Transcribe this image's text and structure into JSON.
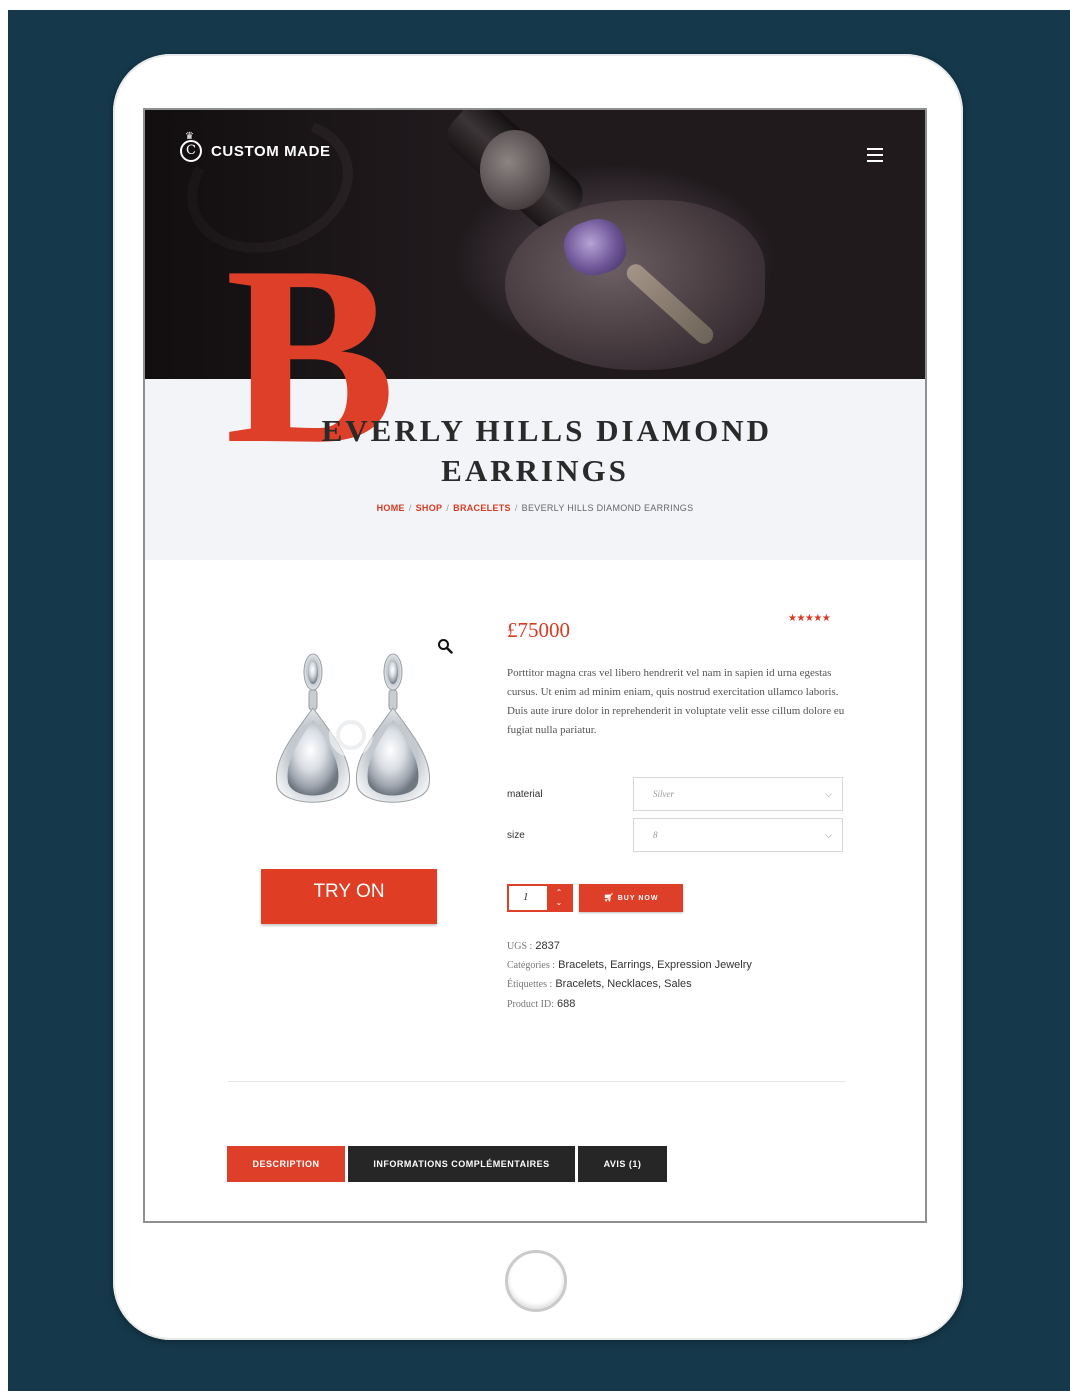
{
  "brand": {
    "name": "CUSTOM MADE",
    "logo_letter": "C"
  },
  "colors": {
    "accent": "#dd3f28",
    "frame_bg": "#15394b",
    "dark_tab": "#262626"
  },
  "page": {
    "title_initial": "B",
    "title_line1_rest": "EVERLY HILLS DIAMOND",
    "title_line2": "EARRINGS"
  },
  "breadcrumb": [
    {
      "label": "HOME"
    },
    {
      "label": "SHOP"
    },
    {
      "label": "BRACELETS"
    },
    {
      "label": "BEVERLY HILLS DIAMOND EARRINGS"
    }
  ],
  "breadcrumb_separator": "/",
  "product": {
    "price": "£75000",
    "rating_stars": "★★★★★",
    "rating_value": 5,
    "description": "Porttitor magna cras vel libero hendrerit vel nam in sapien id urna egestas cursus. Ut enim ad minim eniam, quis nostrud exercitation ullamco laboris. Duis aute irure dolor in reprehenderit in voluptate velit esse cillum dolore eu fugiat nulla pariatur.",
    "try_on_label": "TRY ON",
    "options": {
      "material": {
        "label": "material",
        "value": "Silver"
      },
      "size": {
        "label": "size",
        "value": "8"
      }
    },
    "quantity": "1",
    "buy_label": "BUY NOW",
    "meta": {
      "sku_label": "UGS :",
      "sku": "2837",
      "categories_label": "Catégories :",
      "categories": "Bracelets, Earrings, Expression Jewelry",
      "tags_label": "Étiquettes :",
      "tags": "Bracelets, Necklaces, Sales",
      "id_label": "Product ID:",
      "id": "688"
    }
  },
  "tabs": [
    {
      "label": "DESCRIPTION",
      "active": true
    },
    {
      "label": "INFORMATIONS COMPLÉMENTAIRES",
      "active": false
    },
    {
      "label": "AVIS (1)",
      "active": false
    }
  ],
  "icons": {
    "logo": "crowned-c-logo-icon",
    "menu": "hamburger-menu-icon",
    "zoom": "magnifier-icon",
    "cart": "cart-icon",
    "chevron": "chevron-down-icon",
    "stepper": "up-down-stepper-icon"
  }
}
